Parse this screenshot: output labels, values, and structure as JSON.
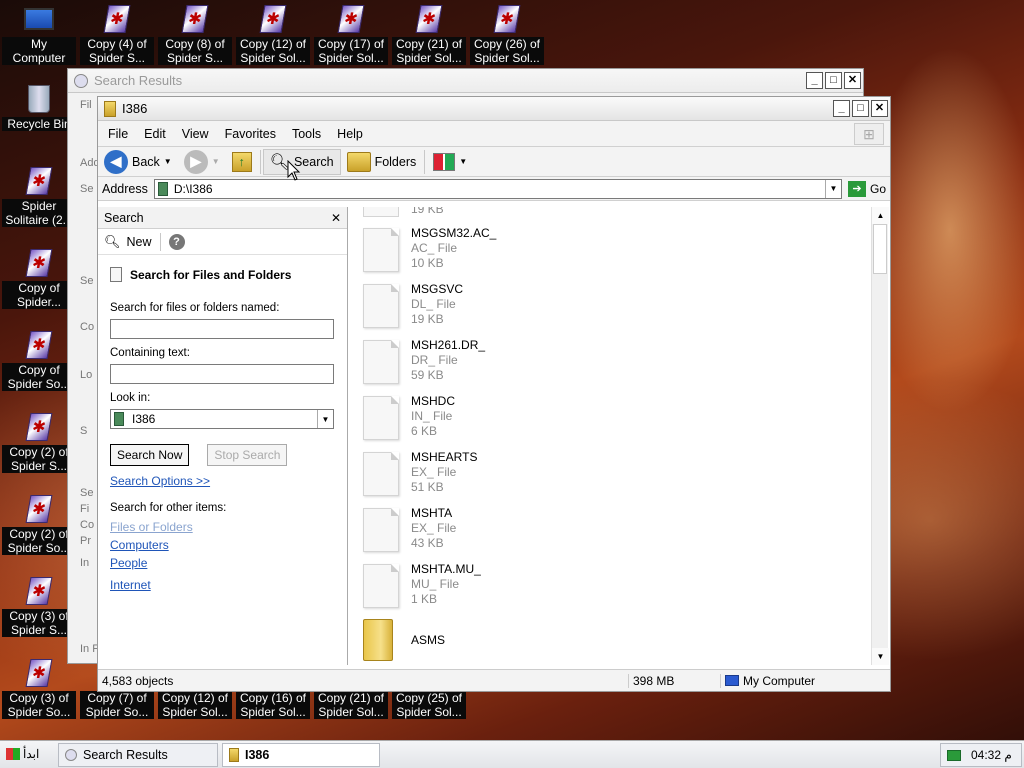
{
  "desktop": {
    "icons_top": [
      "My Computer",
      "Copy (4) of Spider S...",
      "Copy (8) of Spider S...",
      "Copy (12) of Spider Sol...",
      "Copy (17) of Spider Sol...",
      "Copy (21) of Spider Sol...",
      "Copy (26) of Spider Sol..."
    ],
    "icons_left": [
      "Recycle Bin",
      "Spider Solitaire (2...",
      "Copy of Spider...",
      "Copy of Spider So...",
      "Copy (2) of Spider S...",
      "Copy (2) of Spider So...",
      "Copy (3) of Spider S...",
      "Copy (3) of Spider So..."
    ],
    "icons_bottom": [
      "Copy (7) of Spider So...",
      "Copy (12) of Spider Sol...",
      "Copy (16) of Spider Sol...",
      "Copy (21) of Spider Sol...",
      "Copy (25) of Spider Sol..."
    ]
  },
  "back_window": {
    "title": "Search Results",
    "side_fragments": [
      "Fil",
      "Add",
      "Se",
      "Se",
      "Co",
      "Lo",
      "S",
      "Se",
      "Fi",
      "Co",
      "Pr",
      "In",
      "In F"
    ]
  },
  "window": {
    "title": "I386",
    "menu": [
      "File",
      "Edit",
      "View",
      "Favorites",
      "Tools",
      "Help"
    ],
    "toolbar": {
      "back": "Back",
      "search": "Search",
      "folders": "Folders"
    },
    "address": {
      "label": "Address",
      "value": "D:\\I386",
      "go": "Go"
    }
  },
  "search_pane": {
    "header": "Search",
    "new": "New",
    "section_title": "Search for Files and Folders",
    "name_label": "Search for files or folders named:",
    "name_value": "",
    "text_label": "Containing text:",
    "text_value": "",
    "look_in_label": "Look in:",
    "look_in_value": "I386",
    "search_now": "Search Now",
    "stop_search": "Stop Search",
    "options": "Search Options >>",
    "other_label": "Search for other items:",
    "other_links": [
      "Files or Folders",
      "Computers",
      "People"
    ],
    "internet": "Internet"
  },
  "files": {
    "partial_top": "19 KB",
    "items": [
      {
        "name": "MSGSM32.AC_",
        "type": "AC_ File",
        "size": "10 KB"
      },
      {
        "name": "MSGSVC",
        "type": "DL_ File",
        "size": "19 KB"
      },
      {
        "name": "MSH261.DR_",
        "type": "DR_ File",
        "size": "59 KB"
      },
      {
        "name": "MSHDC",
        "type": "IN_ File",
        "size": "6 KB"
      },
      {
        "name": "MSHEARTS",
        "type": "EX_ File",
        "size": "51 KB"
      },
      {
        "name": "MSHTA",
        "type": "EX_ File",
        "size": "43 KB"
      },
      {
        "name": "MSHTA.MU_",
        "type": "MU_ File",
        "size": "1 KB"
      }
    ],
    "folder": "ASMS"
  },
  "status": {
    "objects": "4,583 objects",
    "size": "398 MB",
    "location": "My Computer"
  },
  "taskbar": {
    "start": "ابدأ",
    "tasks": [
      "Search Results",
      "I386"
    ],
    "clock": "04:32 م"
  }
}
